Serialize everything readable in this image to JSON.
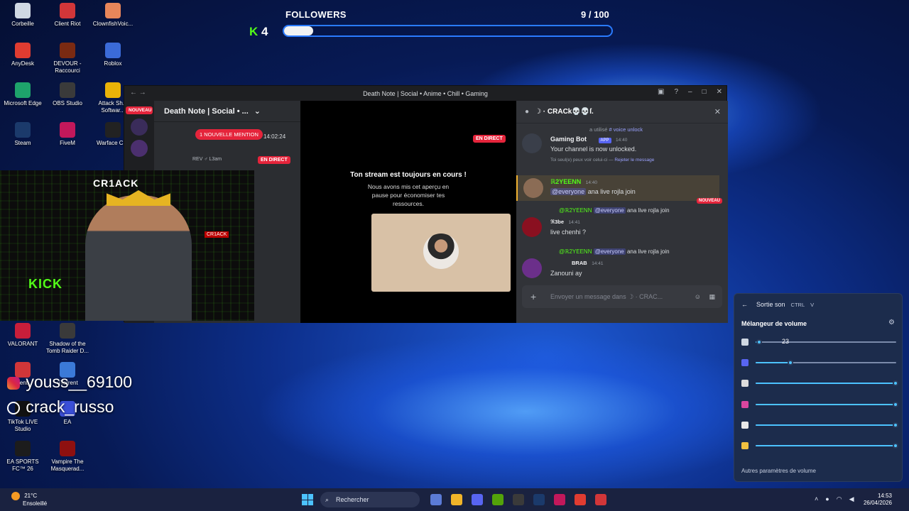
{
  "followers": {
    "title": "FOLLOWERS",
    "count_text": "9 / 100",
    "progress_fraction": 0.09,
    "kick_mini_letter": "K",
    "kick_mini_number": "4"
  },
  "desktop_icons": [
    {
      "label": "Corbeille",
      "color": "#cfd8e3"
    },
    {
      "label": "Client Riot",
      "color": "#d13639"
    },
    {
      "label": "ClownfishVoic...",
      "color": "#e8865a"
    },
    {
      "label": "AnyDesk",
      "color": "#e03c31"
    },
    {
      "label": "DEVOUR - Raccourci",
      "color": "#7a2a12"
    },
    {
      "label": "Roblox",
      "color": "#3b6bd8"
    },
    {
      "label": "Microsoft Edge",
      "color": "#1ea36b"
    },
    {
      "label": "OBS Studio",
      "color": "#3a3a3a"
    },
    {
      "label": "Attack Sh... Softwar...",
      "color": "#eab308"
    },
    {
      "label": "Steam",
      "color": "#1b3a6b"
    },
    {
      "label": "FiveM",
      "color": "#c2185b"
    },
    {
      "label": "Warface Cl...",
      "color": "#222"
    },
    {
      "label": "VALORANT",
      "color": "#c81e3a"
    },
    {
      "label": "Shadow of the Tomb Raider D...",
      "color": "#3a3a3a"
    },
    {
      "label": "Client...",
      "color": "#d13639"
    },
    {
      "label": "uTorrent",
      "color": "#3b7ad8"
    },
    {
      "label": "TikTok LIVE Studio",
      "color": "#111"
    },
    {
      "label": "EA",
      "color": "#3b4fd8"
    },
    {
      "label": "EA SPORTS FC™ 26",
      "color": "#1c1c1c"
    },
    {
      "label": "Vampire The Masquerad...",
      "color": "#8e1010"
    }
  ],
  "discord": {
    "window_title": "Death Note | Social • Anime • Chill • Gaming",
    "server_name": "Death Note | Social • ...",
    "new_badge": "NOUVEAU",
    "new_mention": "1 NOUVELLE MENTION",
    "channel_time": "14:02:24",
    "live_badge": "EN DIRECT",
    "voice_user": "REV ♂ L3am",
    "stream_title": "Ton stream est toujours en cours !",
    "stream_sub": "Nous avons mis cet aperçu en pause pour économiser tes ressources.",
    "chat_title": "☽ · CRACk💀💀ſ.",
    "messages": [
      {
        "reply": "a utilisé",
        "reply_link": "# voice unlock",
        "name": "Gaming Bot",
        "tag": "APP",
        "time": "14:40",
        "text": "Your channel is now unlocked.",
        "note": "Toi seul(e) peux voir celui-ci —",
        "note_link": "Rejeter le message"
      },
      {
        "name": "ℝ2YEENN",
        "time": "14:40",
        "mention": "@everyone",
        "text": "ana live rojla join",
        "new": "NOUVEAU"
      },
      {
        "reply_name": "@ℝ2YEENN",
        "reply_mention": "@everyone",
        "reply_text": "ana live rojla join",
        "name": "ℜ3be",
        "time": "14:41",
        "text": "live chenhi ?"
      },
      {
        "reply_name": "@ℝ2YEENN",
        "reply_mention": "@everyone",
        "reply_text": "ana live rojla join",
        "name": "BRAB",
        "time": "14:41",
        "text": "Zanouni ay"
      }
    ],
    "input_placeholder": "Envoyer un message dans ☽ · CRAC..."
  },
  "kick_card": {
    "title": "CR1ACK",
    "logo": "KICK",
    "tag": "CR1ACK"
  },
  "social": {
    "instagram": "youss__69100",
    "tiktok": "crack_russo"
  },
  "mixer": {
    "output_label": "Sortie son",
    "kbd1": "CTRL",
    "kbd2": "V",
    "title": "Mélangeur de volume",
    "tooltip": "23",
    "sliders": [
      {
        "name": "system",
        "level": 0.03,
        "icon_color": "#cfd8e3"
      },
      {
        "name": "discord",
        "level": 0.25,
        "icon_color": "#5865f2"
      },
      {
        "name": "obs",
        "level": 1.0,
        "icon_color": "#dcdcdc"
      },
      {
        "name": "app-pink",
        "level": 1.0,
        "icon_color": "#d946a0"
      },
      {
        "name": "app-check",
        "level": 1.0,
        "icon_color": "#e8e8e8"
      },
      {
        "name": "app-dot",
        "level": 1.0,
        "icon_color": "#f0c040"
      }
    ],
    "footer": "Autres paramètres de volume"
  },
  "taskbar": {
    "temp": "21°C",
    "weather": "Ensoleillé",
    "search_placeholder": "Rechercher",
    "time": "14:53",
    "date": "26/04/2026"
  },
  "colors": {
    "accent": "#4cc2ff",
    "kick_green": "#53fc18",
    "live_red": "#e5243b",
    "discord_blurple": "#5865f2"
  }
}
